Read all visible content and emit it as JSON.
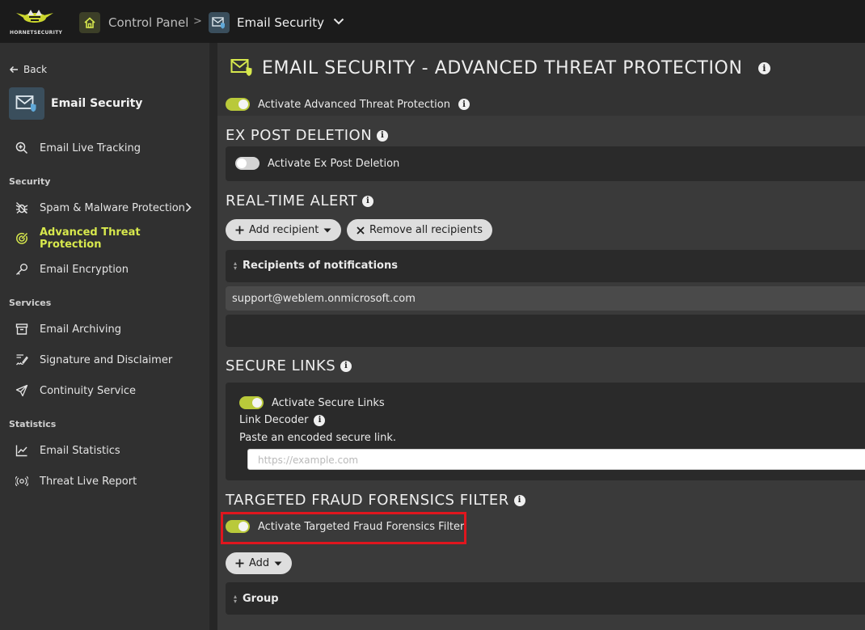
{
  "topbar": {
    "logo_text": "HORNETSECURITY",
    "crumbs": [
      "Control Panel",
      "Email Security"
    ],
    "separator": ">"
  },
  "sidebar": {
    "back_label": "Back",
    "section_title": "Email Security",
    "top_items": [
      {
        "label": "Email Live Tracking",
        "icon": "search-zoom-icon"
      }
    ],
    "categories": [
      {
        "label": "Security",
        "items": [
          {
            "label": "Spam & Malware Protection",
            "icon": "bug-off-icon",
            "has_submenu": true
          },
          {
            "label": "Advanced Threat Protection",
            "icon": "target-icon",
            "active": true
          },
          {
            "label": "Email Encryption",
            "icon": "key-icon"
          }
        ]
      },
      {
        "label": "Services",
        "items": [
          {
            "label": "Email Archiving",
            "icon": "archive-icon"
          },
          {
            "label": "Signature and Disclaimer",
            "icon": "signature-icon"
          },
          {
            "label": "Continuity Service",
            "icon": "send-icon"
          }
        ]
      },
      {
        "label": "Statistics",
        "items": [
          {
            "label": "Email Statistics",
            "icon": "chart-line-icon"
          },
          {
            "label": "Threat Live Report",
            "icon": "radar-icon"
          }
        ]
      }
    ]
  },
  "main": {
    "page_title": "EMAIL SECURITY - ADVANCED THREAT PROTECTION",
    "activate_atp_label": "Activate Advanced Threat Protection",
    "ex_post": {
      "title": "EX POST DELETION",
      "toggle_label": "Activate Ex Post Deletion"
    },
    "realtime": {
      "title": "REAL-TIME ALERT",
      "add_recipient": "Add recipient",
      "remove_all": "Remove all recipients",
      "column_header": "Recipients of notifications",
      "recipients": [
        "support@weblem.onmicrosoft.com"
      ]
    },
    "secure_links": {
      "title": "SECURE LINKS",
      "toggle_label": "Activate Secure Links",
      "decoder_label": "Link Decoder",
      "paste_label": "Paste an encoded secure link.",
      "input_placeholder": "https://example.com"
    },
    "tff": {
      "title": "TARGETED FRAUD FORENSICS FILTER",
      "toggle_label": "Activate Targeted Fraud Forensics Filter",
      "add_label": "Add",
      "column_header": "Group"
    }
  },
  "colors": {
    "accent": "#b9c93a",
    "active_text": "#d7e84d",
    "highlight": "#e0161e",
    "sidebar_bg": "#303030",
    "main_bg": "#3a3a3a"
  }
}
